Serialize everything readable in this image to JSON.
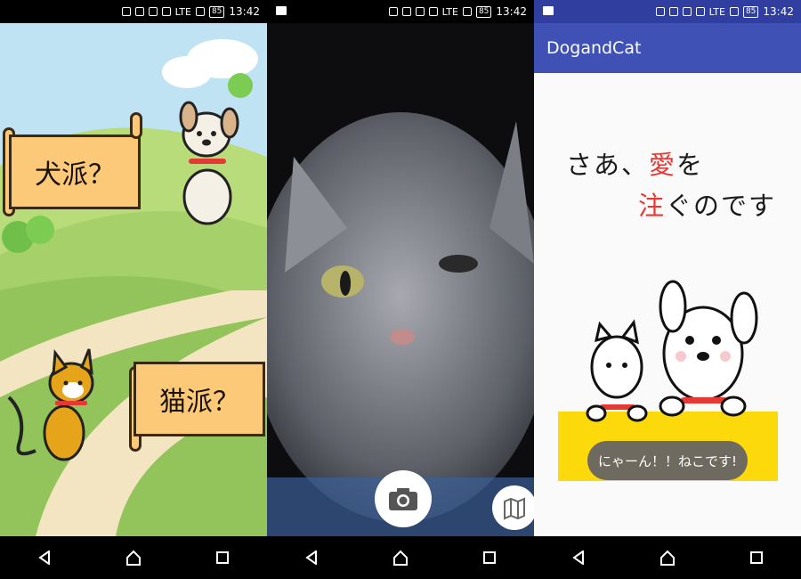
{
  "status": {
    "time": "13:42",
    "battery": "85",
    "network": "LTE"
  },
  "screen1": {
    "dog_button_label": "犬派？",
    "cat_button_label": "猫派？"
  },
  "screen2": {
    "camera_icon": "camera-icon",
    "map_icon": "map-icon"
  },
  "screen3": {
    "app_title": "DogandCat",
    "line1_a": "さあ、",
    "line1_highlight": "愛",
    "line1_b": "を",
    "line2_highlight": "注",
    "line2_b": "ぐのです",
    "cat_says_button": "にゃーん！！ねこです!"
  },
  "colors": {
    "appbar": "#3f51b5",
    "banner": "#fcc978",
    "accent_red": "#e53935",
    "band": "#fbd90a"
  }
}
